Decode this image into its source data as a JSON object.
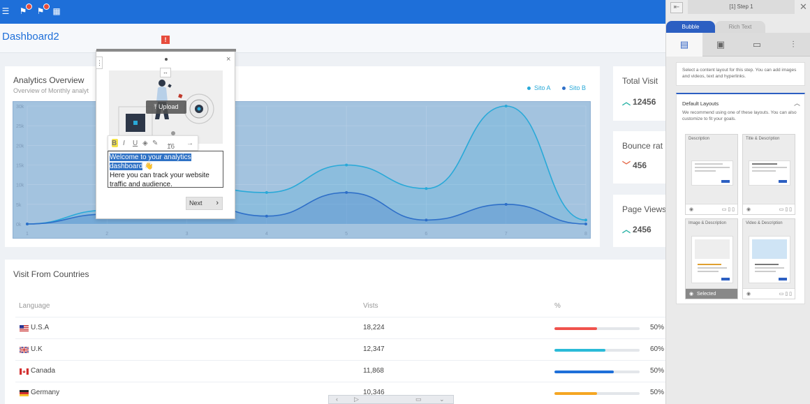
{
  "topbar": {
    "icons": [
      "menu-icon",
      "flag-icon",
      "flag-icon",
      "grid-icon"
    ],
    "colors": {
      "primary": "#1e6fd9"
    }
  },
  "page": {
    "title": "Dashboard2"
  },
  "analytics": {
    "title": "Analytics Overview",
    "subtitle": "Overview of Monthly analyt",
    "legend": [
      {
        "label": "Sito A",
        "color": "#29a9d8"
      },
      {
        "label": "Sito B",
        "color": "#2e6fc8"
      }
    ]
  },
  "chart_data": {
    "type": "area",
    "x": [
      1,
      2,
      3,
      4,
      5,
      6,
      7,
      8
    ],
    "series": [
      {
        "name": "Sito A",
        "values": [
          0,
          7,
          20,
          16,
          30,
          18,
          60,
          2
        ],
        "color": "#29a9d8"
      },
      {
        "name": "Sito B",
        "values": [
          0,
          5,
          12,
          4,
          16,
          2,
          10,
          0
        ],
        "color": "#2e6fc8"
      }
    ],
    "xticks": [
      "1",
      "2",
      "3",
      "4",
      "5",
      "6",
      "7",
      "8"
    ],
    "yticks": [
      "0k",
      "5k",
      "10k",
      "15k",
      "20k",
      "25k",
      "30k"
    ],
    "ylim": [
      0,
      60
    ],
    "grid": true
  },
  "stats": [
    {
      "label": "Total Visit",
      "value": "12456",
      "trend": "up"
    },
    {
      "label": "Bounce rat",
      "value": "456",
      "trend": "down"
    },
    {
      "label": "Page Views",
      "value": "2456",
      "trend": "up"
    }
  ],
  "countries": {
    "title": "Visit From Countries",
    "headers": {
      "language": "Language",
      "visits": "Vists",
      "percent": "%"
    },
    "rows": [
      {
        "name": "U.S.A",
        "visits": "18,224",
        "percent": "50%",
        "value": 0.5,
        "color": "#f0524d",
        "flag": "usa-flag-icon"
      },
      {
        "name": "U.K",
        "visits": "12,347",
        "percent": "60%",
        "value": 0.6,
        "color": "#2bbbd8",
        "flag": "uk-flag-icon"
      },
      {
        "name": "Canada",
        "visits": "11,868",
        "percent": "50%",
        "value": 0.7,
        "color": "#1e6fd9",
        "flag": "canada-flag-icon"
      },
      {
        "name": "Germany",
        "visits": "10,346",
        "percent": "50%",
        "value": 0.5,
        "color": "#f5a623",
        "flag": "germany-flag-icon"
      }
    ]
  },
  "bubble": {
    "upload_label": "Upload",
    "font_size": "16",
    "text_heading": "Welcome to your analytics dashboard",
    "text_emoji": "👋",
    "text_body": "Here you can track your website traffic and audience.",
    "next_label": "Next"
  },
  "panel": {
    "step_label": "[1] Step 1",
    "tabs": [
      "Bubble",
      "Rich Text"
    ],
    "info_text": "Select a content layout for this step. You can add images and videos, text and hyperlinks.",
    "layouts_title": "Default Layouts",
    "layouts_desc": "We recommend using one of these layouts. You can also customize to fit your goals.",
    "layout_cards": [
      "Description",
      "Title & Description",
      "Image & Description",
      "Video & Description"
    ],
    "selected_label": "Selected"
  }
}
